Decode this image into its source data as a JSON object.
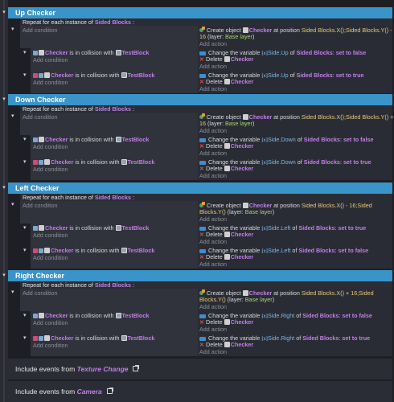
{
  "labels": {
    "add_condition": "Add condition",
    "add_action": "Add action",
    "repeat_prefix": "Repeat for each instance of",
    "repeat_object": "Sided Blocks",
    "repeat_suffix": ":",
    "collision_mid": "is in collision with",
    "checker": "Checker",
    "testblock": "TestBlock",
    "change_var": "Change the variable",
    "of": "of",
    "delete": "Delete",
    "create_object": "Create object",
    "at_position": "at position",
    "layer_prefix": "(layer:",
    "base_layer": "Base layer",
    "layer_suffix": ")",
    "sided_blocks": "Sided Blocks",
    "include_prefix": "Include events from"
  },
  "groups": [
    {
      "title": "Up Checker",
      "create_pos": "Sided Blocks.X();Sided Blocks.Y() -",
      "create_pos2": "16",
      "rules": [
        {
          "var": "Side.Up",
          "set": "set to false"
        },
        {
          "var": "Side.Up",
          "set": "set to true"
        }
      ]
    },
    {
      "title": "Down Checker",
      "create_pos": "Sided Blocks.X();Sided Blocks.Y() +",
      "create_pos2": "16",
      "rules": [
        {
          "var": "Side.Down",
          "set": "set to false"
        },
        {
          "var": "Side.Down",
          "set": "set to true"
        }
      ]
    },
    {
      "title": "Left Checker",
      "create_pos": "Sided Blocks.X() - 16;Sided",
      "create_pos2": "Blocks.Y()",
      "rules": [
        {
          "var": "Side.Left",
          "set": "set to true"
        },
        {
          "var": "Side.Left",
          "set": "set to false"
        }
      ]
    },
    {
      "title": "Right Checker",
      "create_pos": "Sided Blocks.X() + 16;Sided",
      "create_pos2": "Blocks.Y()",
      "rules": [
        {
          "var": "Side.Right",
          "set": "set to false"
        },
        {
          "var": "Side.Right",
          "set": "set to true"
        }
      ]
    }
  ],
  "includes": [
    {
      "name": "Texture Change"
    },
    {
      "name": "Camera"
    }
  ],
  "colors": {
    "group_header": "#3a93c9",
    "object": "#c07ee8",
    "operand": "#e8c77a",
    "layer": "#a5d66f",
    "variable": "#79b7e7"
  },
  "icons": {
    "collapse": "chevron-down-icon",
    "object": "object-icon",
    "testblock": "tiled-sprite-icon",
    "variable": "variable-icon",
    "delete": "delete-x-icon",
    "create": "create-object-icon",
    "collision": "collision-icon",
    "external": "external-link-icon"
  }
}
